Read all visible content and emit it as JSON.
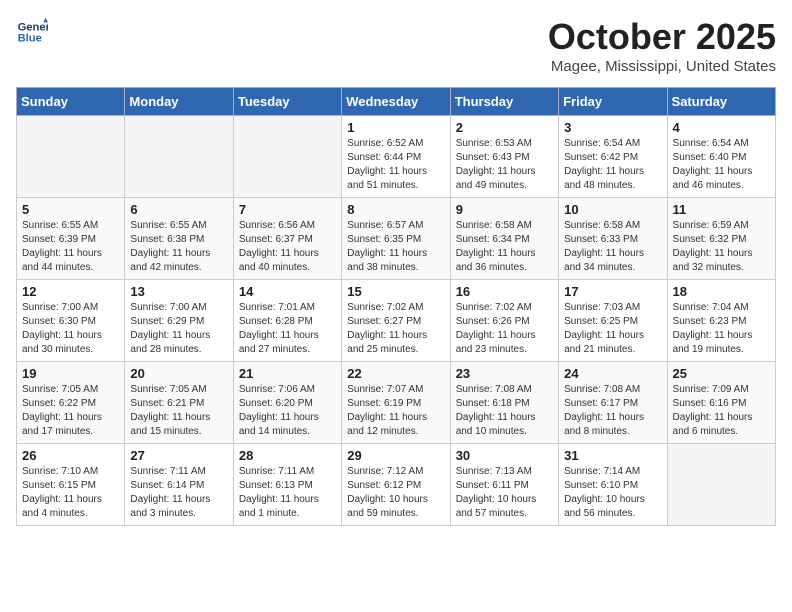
{
  "header": {
    "logo_line1": "General",
    "logo_line2": "Blue",
    "month_title": "October 2025",
    "location": "Magee, Mississippi, United States"
  },
  "days_of_week": [
    "Sunday",
    "Monday",
    "Tuesday",
    "Wednesday",
    "Thursday",
    "Friday",
    "Saturday"
  ],
  "weeks": [
    [
      {
        "day": "",
        "empty": true
      },
      {
        "day": "",
        "empty": true
      },
      {
        "day": "",
        "empty": true
      },
      {
        "day": "1",
        "sunrise": "6:52 AM",
        "sunset": "6:44 PM",
        "daylight": "11 hours and 51 minutes."
      },
      {
        "day": "2",
        "sunrise": "6:53 AM",
        "sunset": "6:43 PM",
        "daylight": "11 hours and 49 minutes."
      },
      {
        "day": "3",
        "sunrise": "6:54 AM",
        "sunset": "6:42 PM",
        "daylight": "11 hours and 48 minutes."
      },
      {
        "day": "4",
        "sunrise": "6:54 AM",
        "sunset": "6:40 PM",
        "daylight": "11 hours and 46 minutes."
      }
    ],
    [
      {
        "day": "5",
        "sunrise": "6:55 AM",
        "sunset": "6:39 PM",
        "daylight": "11 hours and 44 minutes."
      },
      {
        "day": "6",
        "sunrise": "6:55 AM",
        "sunset": "6:38 PM",
        "daylight": "11 hours and 42 minutes."
      },
      {
        "day": "7",
        "sunrise": "6:56 AM",
        "sunset": "6:37 PM",
        "daylight": "11 hours and 40 minutes."
      },
      {
        "day": "8",
        "sunrise": "6:57 AM",
        "sunset": "6:35 PM",
        "daylight": "11 hours and 38 minutes."
      },
      {
        "day": "9",
        "sunrise": "6:58 AM",
        "sunset": "6:34 PM",
        "daylight": "11 hours and 36 minutes."
      },
      {
        "day": "10",
        "sunrise": "6:58 AM",
        "sunset": "6:33 PM",
        "daylight": "11 hours and 34 minutes."
      },
      {
        "day": "11",
        "sunrise": "6:59 AM",
        "sunset": "6:32 PM",
        "daylight": "11 hours and 32 minutes."
      }
    ],
    [
      {
        "day": "12",
        "sunrise": "7:00 AM",
        "sunset": "6:30 PM",
        "daylight": "11 hours and 30 minutes."
      },
      {
        "day": "13",
        "sunrise": "7:00 AM",
        "sunset": "6:29 PM",
        "daylight": "11 hours and 28 minutes."
      },
      {
        "day": "14",
        "sunrise": "7:01 AM",
        "sunset": "6:28 PM",
        "daylight": "11 hours and 27 minutes."
      },
      {
        "day": "15",
        "sunrise": "7:02 AM",
        "sunset": "6:27 PM",
        "daylight": "11 hours and 25 minutes."
      },
      {
        "day": "16",
        "sunrise": "7:02 AM",
        "sunset": "6:26 PM",
        "daylight": "11 hours and 23 minutes."
      },
      {
        "day": "17",
        "sunrise": "7:03 AM",
        "sunset": "6:25 PM",
        "daylight": "11 hours and 21 minutes."
      },
      {
        "day": "18",
        "sunrise": "7:04 AM",
        "sunset": "6:23 PM",
        "daylight": "11 hours and 19 minutes."
      }
    ],
    [
      {
        "day": "19",
        "sunrise": "7:05 AM",
        "sunset": "6:22 PM",
        "daylight": "11 hours and 17 minutes."
      },
      {
        "day": "20",
        "sunrise": "7:05 AM",
        "sunset": "6:21 PM",
        "daylight": "11 hours and 15 minutes."
      },
      {
        "day": "21",
        "sunrise": "7:06 AM",
        "sunset": "6:20 PM",
        "daylight": "11 hours and 14 minutes."
      },
      {
        "day": "22",
        "sunrise": "7:07 AM",
        "sunset": "6:19 PM",
        "daylight": "11 hours and 12 minutes."
      },
      {
        "day": "23",
        "sunrise": "7:08 AM",
        "sunset": "6:18 PM",
        "daylight": "11 hours and 10 minutes."
      },
      {
        "day": "24",
        "sunrise": "7:08 AM",
        "sunset": "6:17 PM",
        "daylight": "11 hours and 8 minutes."
      },
      {
        "day": "25",
        "sunrise": "7:09 AM",
        "sunset": "6:16 PM",
        "daylight": "11 hours and 6 minutes."
      }
    ],
    [
      {
        "day": "26",
        "sunrise": "7:10 AM",
        "sunset": "6:15 PM",
        "daylight": "11 hours and 4 minutes."
      },
      {
        "day": "27",
        "sunrise": "7:11 AM",
        "sunset": "6:14 PM",
        "daylight": "11 hours and 3 minutes."
      },
      {
        "day": "28",
        "sunrise": "7:11 AM",
        "sunset": "6:13 PM",
        "daylight": "11 hours and 1 minute."
      },
      {
        "day": "29",
        "sunrise": "7:12 AM",
        "sunset": "6:12 PM",
        "daylight": "10 hours and 59 minutes."
      },
      {
        "day": "30",
        "sunrise": "7:13 AM",
        "sunset": "6:11 PM",
        "daylight": "10 hours and 57 minutes."
      },
      {
        "day": "31",
        "sunrise": "7:14 AM",
        "sunset": "6:10 PM",
        "daylight": "10 hours and 56 minutes."
      },
      {
        "day": "",
        "empty": true
      }
    ]
  ]
}
